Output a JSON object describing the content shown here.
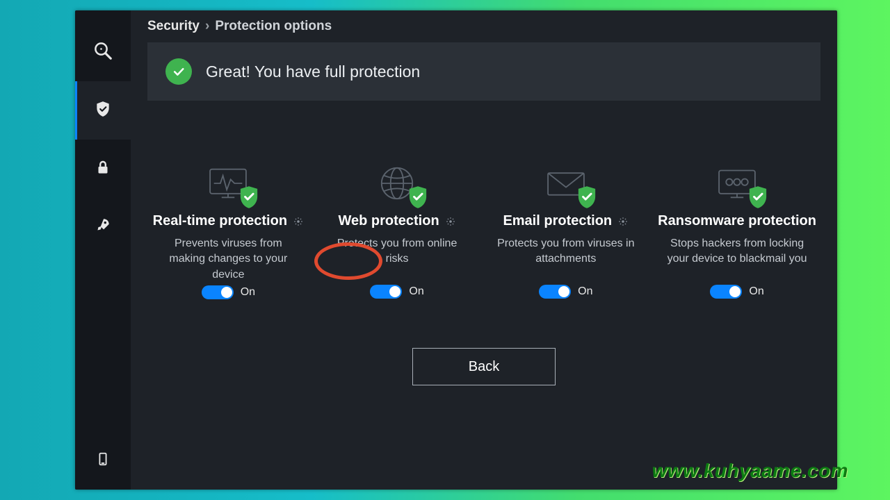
{
  "breadcrumb": {
    "root": "Security",
    "separator": "›",
    "current": "Protection options"
  },
  "banner": {
    "text": "Great! You have full protection"
  },
  "cards": [
    {
      "title": "Real-time protection",
      "desc": "Prevents viruses from making changes to your device",
      "toggle": "On",
      "has_gear": true
    },
    {
      "title": "Web protection",
      "desc": "Protects you from online risks",
      "toggle": "On",
      "has_gear": true
    },
    {
      "title": "Email protection",
      "desc": "Protects you from viruses in attachments",
      "toggle": "On",
      "has_gear": true
    },
    {
      "title": "Ransomware protection",
      "desc": "Stops hackers from locking your device to blackmail you",
      "toggle": "On",
      "has_gear": false
    }
  ],
  "back_button": "Back",
  "watermark": "www.kuhyaame.com"
}
